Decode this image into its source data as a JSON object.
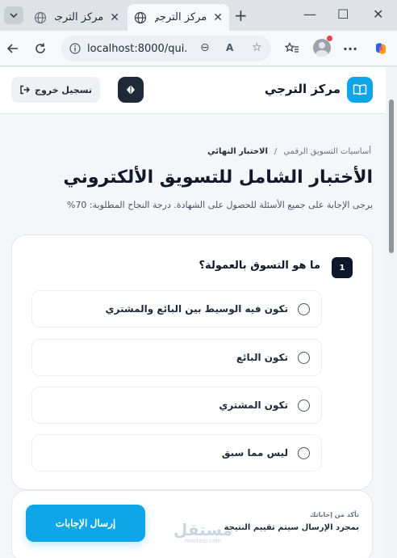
{
  "browser": {
    "tabs": [
      {
        "title": "مركز الترجي",
        "active": false
      },
      {
        "title": "مركز الترجي",
        "active": true
      }
    ],
    "url": "localhost:8000/qui..."
  },
  "header": {
    "brand_name": "مركز الترجي",
    "logout_label": "تسجيل خروج"
  },
  "breadcrumb": {
    "parent": "أساسيات التسويق الرقمي",
    "separator": "/",
    "current": "الاختبار النهائي"
  },
  "exam": {
    "title": "الأختبار الشامل للتسويق الألكتروني",
    "subtitle": "يرجى الإجابة على جميع الأسئلة للحصول على الشهادة. درجة النجاح المطلوبة: 70%"
  },
  "question": {
    "number": "1",
    "text": "ما هو التسوق بالعمولة؟",
    "options": [
      "تكون فيه الوسيط بين البائع والمشتري",
      "تكون البائع",
      "تكون المشتري",
      "ليس مما سبق"
    ]
  },
  "submit": {
    "confirm_title": "تأكد من إجاباتك",
    "confirm_text": "بمجرد الإرسال سيتم تقييم النتيجة",
    "button_label": "إرسال الإجابات"
  },
  "watermark": {
    "arabic": "مستقل",
    "latin": "mostaql.com"
  },
  "colors": {
    "accent": "#0ea5e9",
    "dark": "#0f172a"
  }
}
